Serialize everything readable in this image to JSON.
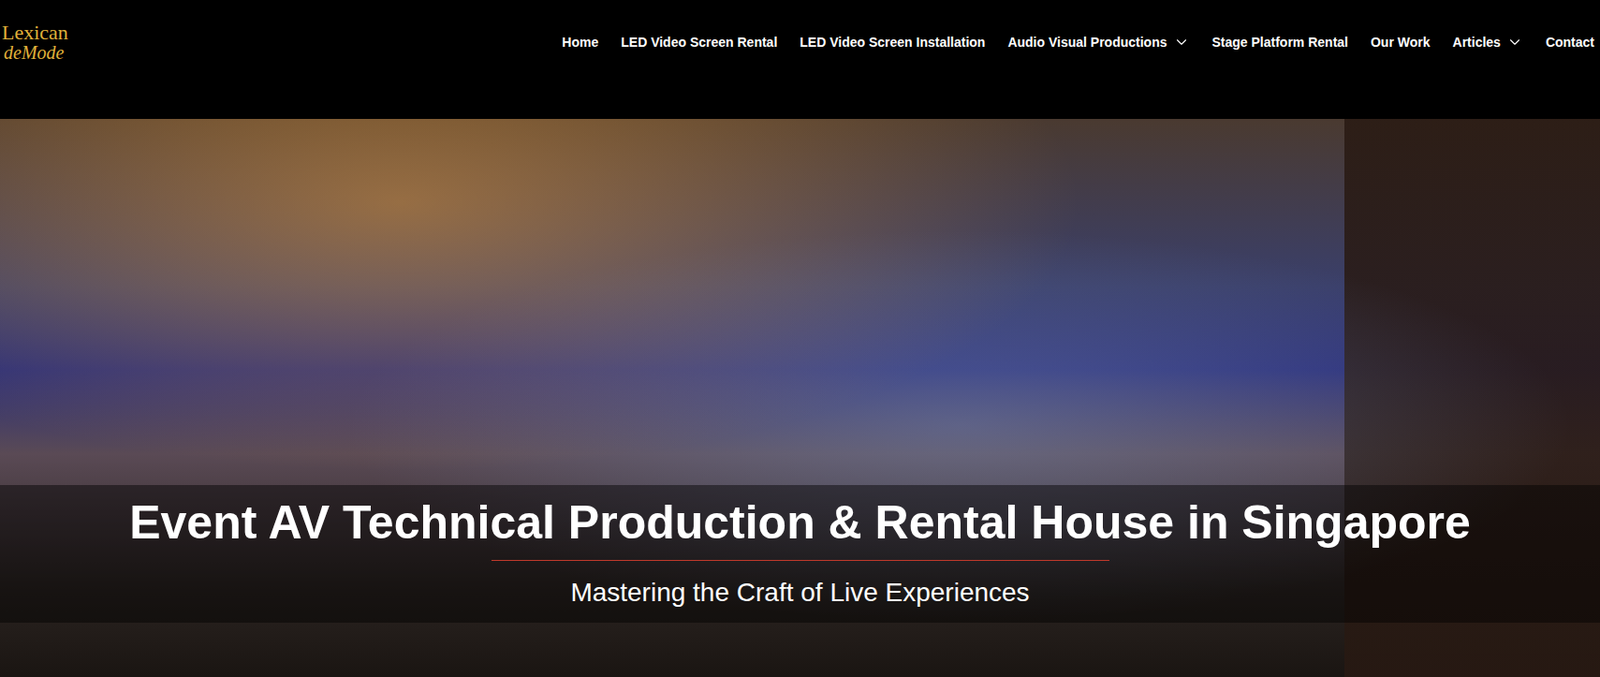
{
  "logo": {
    "line1": "Lexican",
    "line2": "deMode"
  },
  "nav": [
    {
      "label": "Home",
      "hasMenu": false
    },
    {
      "label": "LED Video Screen Rental",
      "hasMenu": false
    },
    {
      "label": "LED Video Screen Installation",
      "hasMenu": false
    },
    {
      "label": "Audio Visual Productions",
      "hasMenu": true
    },
    {
      "label": "Stage Platform Rental",
      "hasMenu": false
    },
    {
      "label": "Our Work",
      "hasMenu": false
    },
    {
      "label": "Articles",
      "hasMenu": true
    },
    {
      "label": "Contact",
      "hasMenu": false
    }
  ],
  "hero": {
    "title": "Event AV Technical Production & Rental House in Singapore",
    "subtitle": "Mastering the Craft of Live Experiences"
  }
}
